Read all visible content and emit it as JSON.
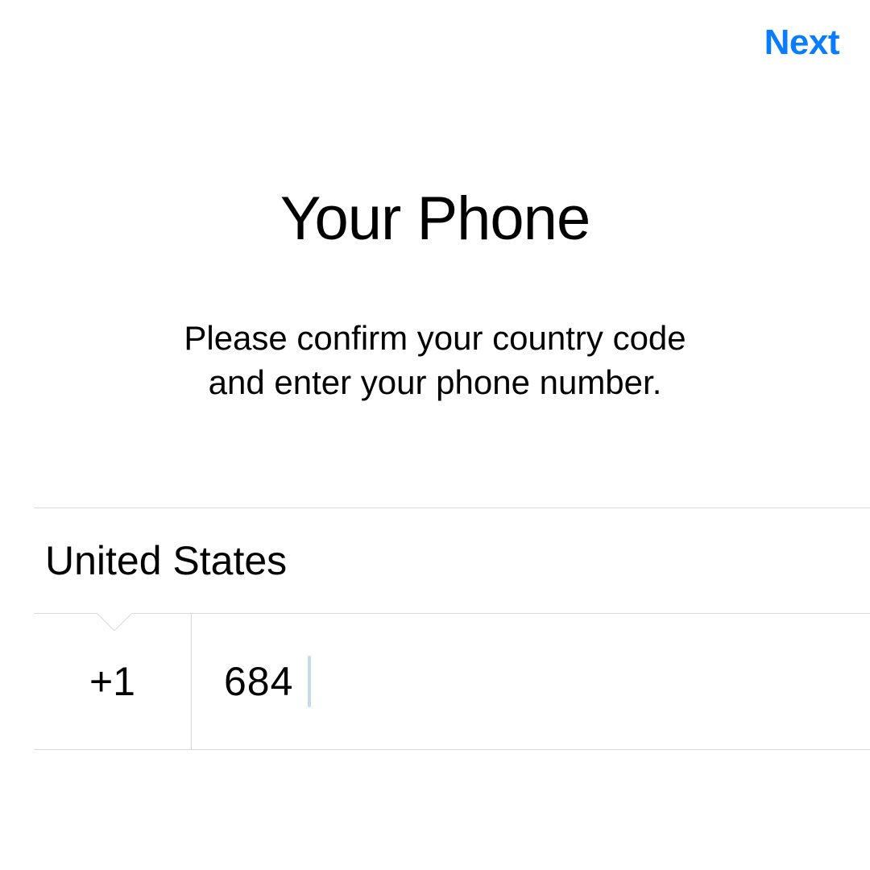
{
  "nav": {
    "next_label": "Next"
  },
  "header": {
    "title": "Your Phone",
    "subtitle_line1": "Please confirm your country code",
    "subtitle_line2": "and enter your phone number."
  },
  "form": {
    "country_name": "United States",
    "country_code": "+1",
    "phone_value": "684"
  },
  "colors": {
    "accent": "#0a7cff",
    "separator": "#d9d9d9",
    "caret": "#c5d9ea"
  }
}
